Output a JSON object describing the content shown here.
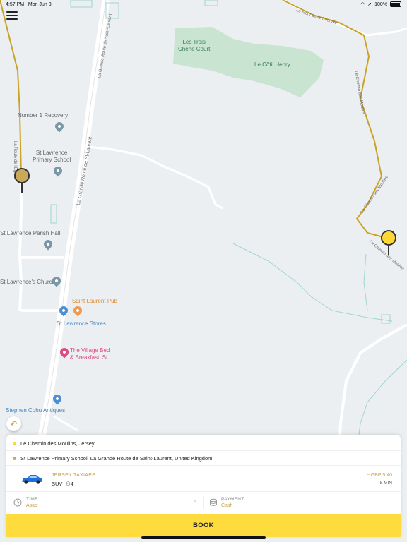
{
  "status_bar": {
    "time": "4:57 PM",
    "date": "Mon Jun 3",
    "battery": "100%"
  },
  "map": {
    "areas": [
      {
        "name": "Les Trois Chêne Court",
        "lines": [
          "Les Trois",
          "Chêne Court"
        ]
      },
      {
        "name": "Le Côtil Henry"
      }
    ],
    "pois": [
      {
        "name": "Number 1 Recovery"
      },
      {
        "name": "St Lawrence Primary School",
        "lines": [
          "St Lawrence",
          "Primary School"
        ]
      },
      {
        "name": "St Lawrence Parish Hall"
      },
      {
        "name": "St Lawrence's Church"
      },
      {
        "name": "Saint Laurent Pub"
      },
      {
        "name": "St Lawrence Stores"
      },
      {
        "name": "The Village Bed & Breakfast, St...",
        "lines": [
          "The Village Bed",
          "& Breakfast, St..."
        ]
      },
      {
        "name": "Stephen Cohu Antiques"
      }
    ],
    "roads": {
      "grande_route": "La Grande Route de Saint-Laurent",
      "route_eglise": "La Route de l'Église",
      "chemin_moulins": "Le Chemin des Moulins",
      "mont_chenaie": "Le Mont de la Chenaie",
      "chemin_moulins2": "Le Chemin des Moulins",
      "chemin_moulins3": "Le Chemin des Moulins",
      "route_grande_top": "La Grande Route de St-Laurent"
    },
    "colors": {
      "pickup_pin": "#fdd835",
      "dropoff_pin": "#c8a95a",
      "route": "#c9a227"
    }
  },
  "booking": {
    "pickup": "Le Chemin des Moulins, Jersey",
    "dropoff": "St Lawrence Primary School, La Grande Route de Saint-Laurent, United Kingdom",
    "ride": {
      "company": "JERSEY TAXIAPP",
      "vehicle": "SUV",
      "seats": "4",
      "price": "~ GBP 5.40",
      "eta": "8 MIN"
    },
    "time": {
      "label": "TIME",
      "value": "Asap"
    },
    "payment": {
      "label": "PAYMENT",
      "value": "Cash"
    },
    "book_label": "BOOK"
  },
  "colors": {
    "accent": "#fedc3d",
    "gold": "#c8a24a"
  }
}
